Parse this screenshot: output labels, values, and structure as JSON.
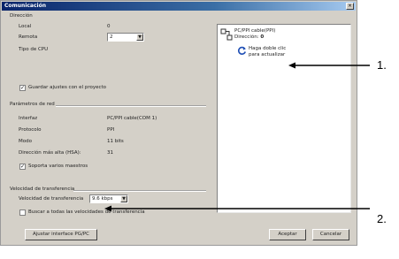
{
  "window": {
    "title": "Comunicación",
    "close_label": "×"
  },
  "address": {
    "group_label": "Dirección",
    "local_label": "Local",
    "local_value": "0",
    "remote_label": "Remota",
    "remote_value": "2",
    "cpu_type_label": "Tipo de CPU",
    "save_settings_label": "Guardar ajustes con el proyecto",
    "save_settings_checked": true
  },
  "network": {
    "group_label": "Parámetros de red",
    "rows": [
      {
        "label": "Interfaz",
        "value": "PC/PPI cable(COM 1)"
      },
      {
        "label": "Protocolo",
        "value": "PPI"
      },
      {
        "label": "Modo",
        "value": "11 bits"
      },
      {
        "label": "Dirección más alta (HSA):",
        "value": "31"
      }
    ],
    "multimaster_label": "Soporta varios maestros",
    "multimaster_checked": true
  },
  "speed": {
    "group_label": "Velocidad de transferencia",
    "rate_label": "Velocidad de transferencia",
    "rate_value": "9.6 kbps",
    "search_all_label": "Buscar a todas las velocidades de transferencia",
    "search_all_checked": false
  },
  "tree": {
    "cable_line1": "PC/PPI cable(PPI)",
    "cable_line2_prefix": "Dirección:",
    "cable_line2_value": "0",
    "refresh_line1": "Haga doble clic",
    "refresh_line2": "para actualizar"
  },
  "buttons": {
    "set_interface": "Ajustar interface PG/PC",
    "accept": "Aceptar",
    "cancel": "Cancelar"
  },
  "callouts": {
    "one": "1.",
    "two": "2."
  }
}
